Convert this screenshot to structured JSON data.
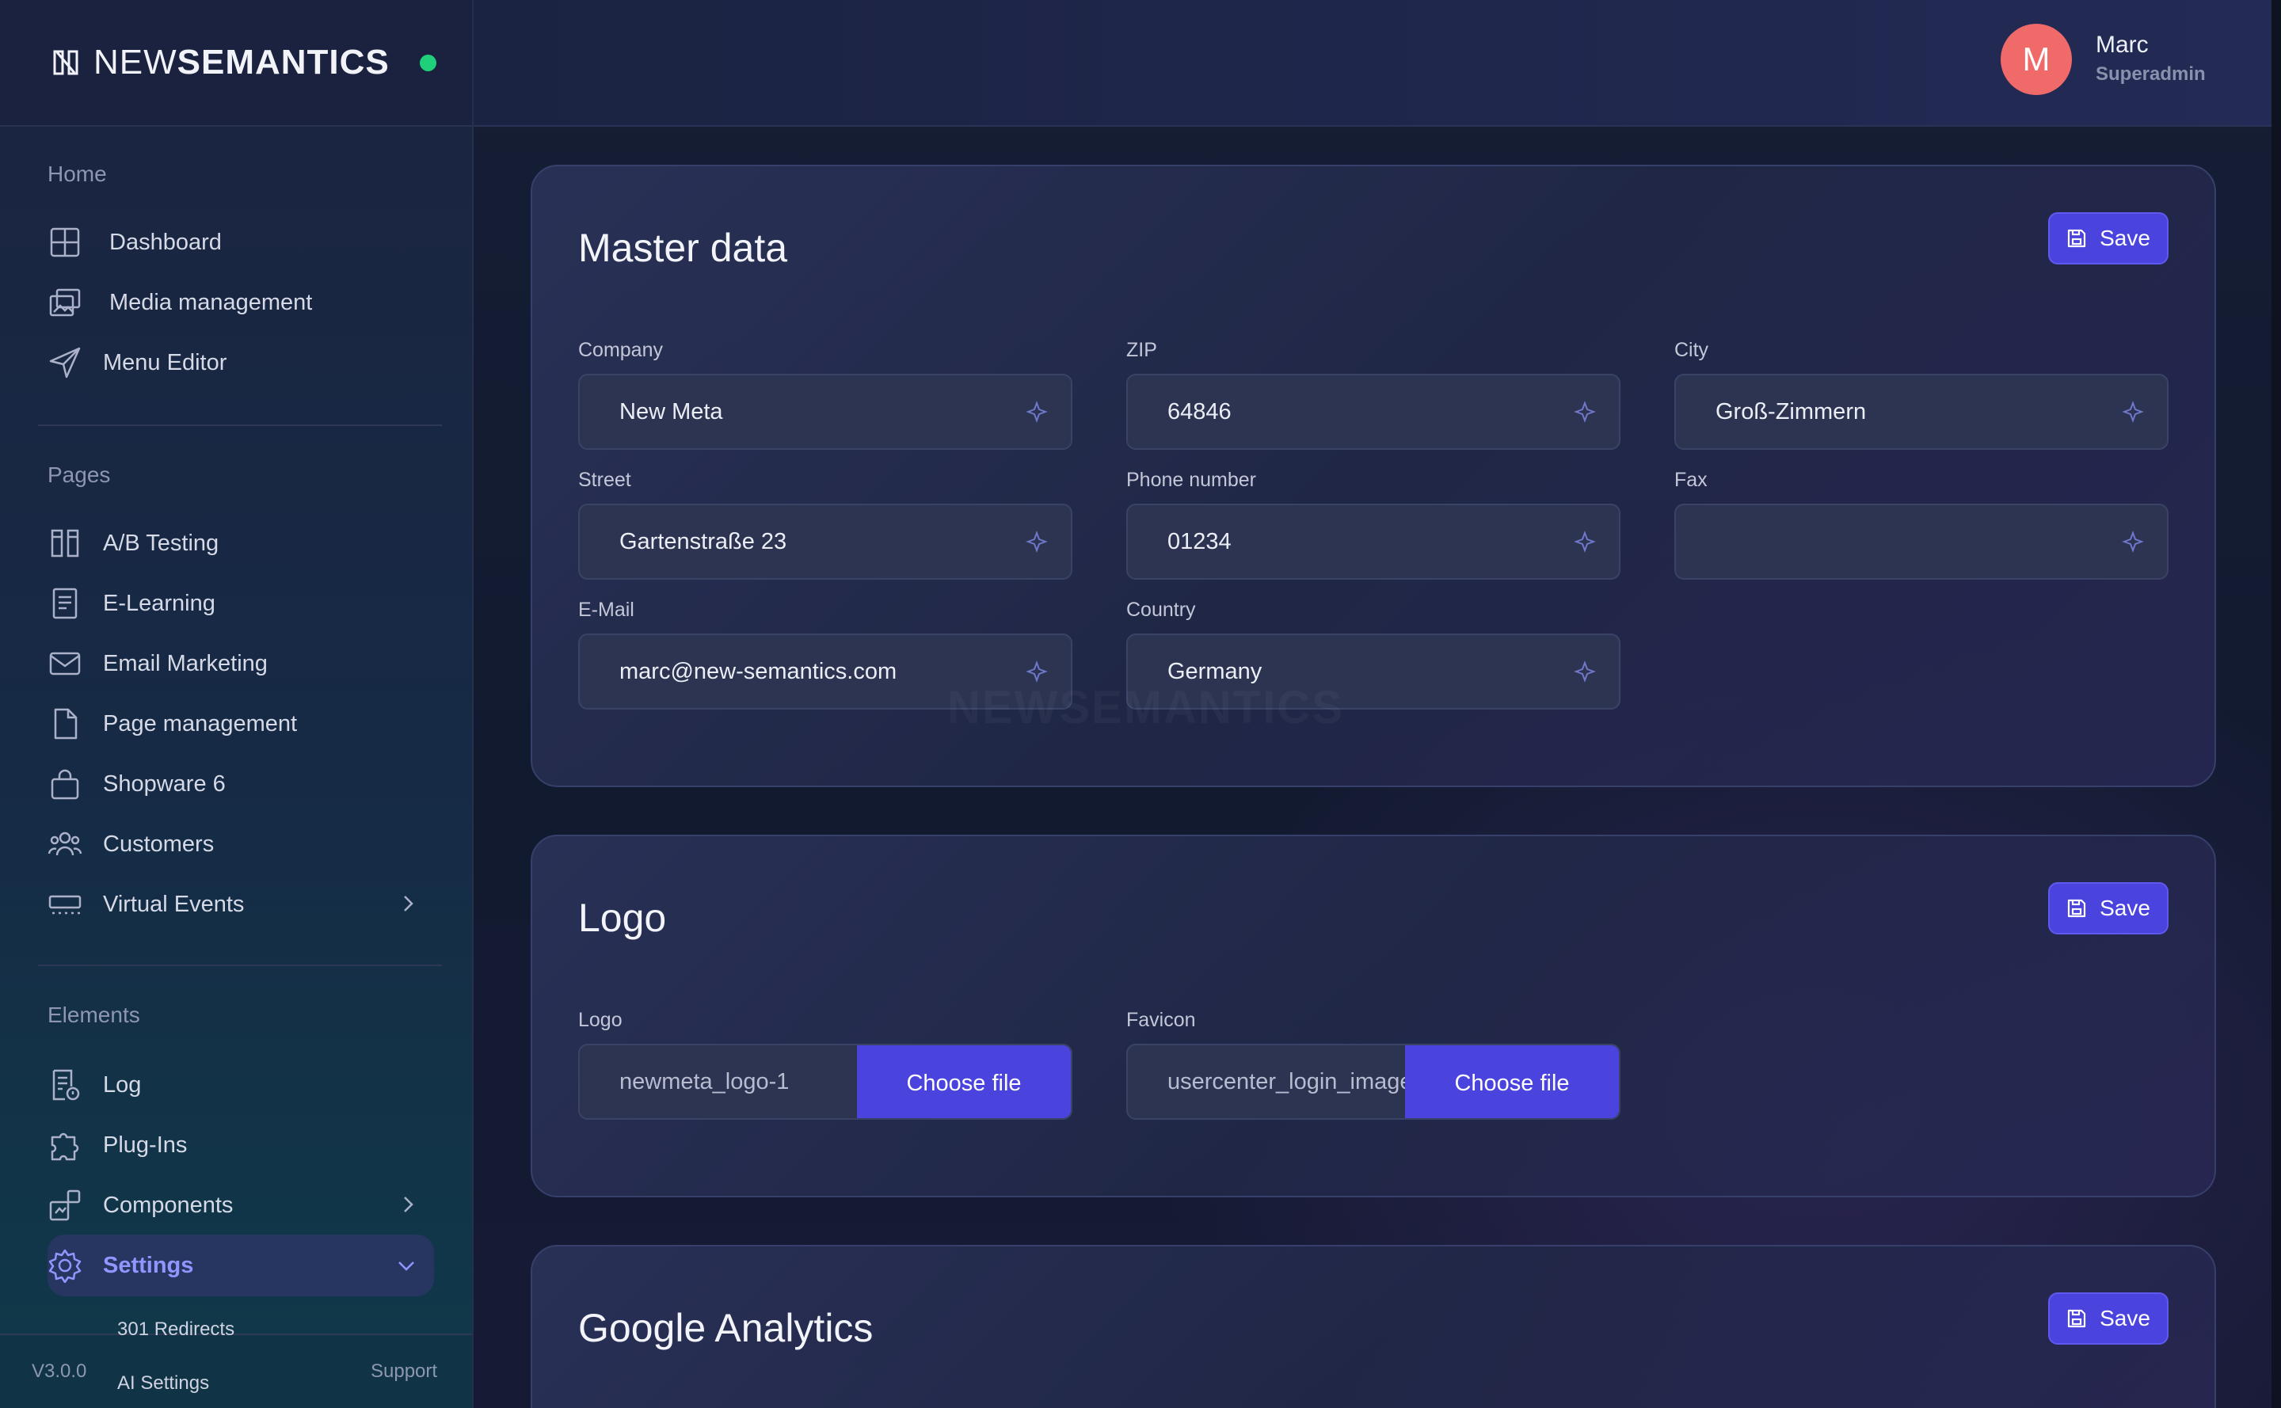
{
  "brand": {
    "name_light": "NEW",
    "name_bold": "SEMANTICS",
    "status_color": "#1fcf7a"
  },
  "user": {
    "initial": "M",
    "name": "Marc",
    "role": "Superadmin",
    "avatar_color": "#f06a6a"
  },
  "sidebar": {
    "sections": [
      {
        "title": "Home",
        "items": [
          {
            "label": "Dashboard",
            "icon": "grid-icon"
          },
          {
            "label": "Media management",
            "icon": "images-icon"
          },
          {
            "label": "Menu Editor",
            "icon": "send-icon"
          }
        ]
      },
      {
        "title": "Pages",
        "items": [
          {
            "label": "A/B Testing",
            "icon": "columns-icon"
          },
          {
            "label": "E-Learning",
            "icon": "book-icon"
          },
          {
            "label": "Email Marketing",
            "icon": "mail-icon"
          },
          {
            "label": "Page management",
            "icon": "file-icon"
          },
          {
            "label": "Shopware 6",
            "icon": "bag-icon"
          },
          {
            "label": "Customers",
            "icon": "users-icon"
          },
          {
            "label": "Virtual Events",
            "icon": "display-icon"
          }
        ]
      },
      {
        "title": "Elements",
        "items": [
          {
            "label": "Log",
            "icon": "log-icon"
          },
          {
            "label": "Plug-Ins",
            "icon": "puzzle-icon"
          },
          {
            "label": "Components",
            "icon": "components-icon"
          },
          {
            "label": "Settings",
            "icon": "gear-icon"
          }
        ]
      }
    ],
    "settings_sub": [
      "301 Redirects",
      "AI Settings"
    ],
    "version": "V3.0.0",
    "support": "Support"
  },
  "master_data": {
    "title": "Master data",
    "save_label": "Save",
    "fields": {
      "company": {
        "label": "Company",
        "value": "New Meta"
      },
      "zip": {
        "label": "ZIP",
        "value": "64846"
      },
      "city": {
        "label": "City",
        "value": "Groß-Zimmern"
      },
      "street": {
        "label": "Street",
        "value": "Gartenstraße 23"
      },
      "phone": {
        "label": "Phone number",
        "value": "01234"
      },
      "fax": {
        "label": "Fax",
        "value": ""
      },
      "email": {
        "label": "E-Mail",
        "value": "marc@new-semantics.com"
      },
      "country": {
        "label": "Country",
        "value": "Germany"
      }
    }
  },
  "logo": {
    "title": "Logo",
    "save_label": "Save",
    "logo_label": "Logo",
    "logo_file": "newmeta_logo-1",
    "favicon_label": "Favicon",
    "favicon_file": "usercenter_login_image",
    "choose_label": "Choose file"
  },
  "analytics": {
    "title": "Google Analytics",
    "save_label": "Save"
  },
  "watermark": "NEWSEMANTICS",
  "colors": {
    "accent": "#4a43de",
    "active_nav": "#8f97ff"
  }
}
